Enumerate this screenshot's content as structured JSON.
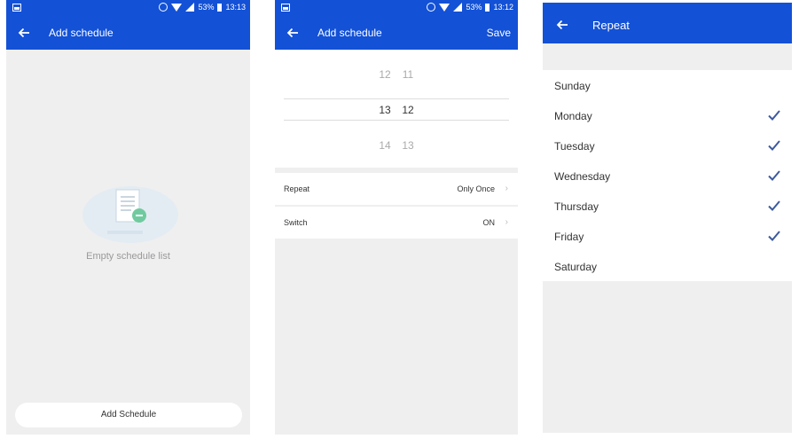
{
  "screen1": {
    "status": {
      "battery": "53%",
      "time": "13:13"
    },
    "title": "Add schedule",
    "empty_text": "Empty schedule list",
    "add_button": "Add Schedule"
  },
  "screen2": {
    "status": {
      "battery": "53%",
      "time": "13:12"
    },
    "title": "Add schedule",
    "save": "Save",
    "picker": {
      "above": [
        "12",
        "11"
      ],
      "selected": [
        "13",
        "12"
      ],
      "below": [
        "14",
        "13"
      ]
    },
    "repeat": {
      "label": "Repeat",
      "value": "Only Once"
    },
    "switch": {
      "label": "Switch",
      "value": "ON"
    }
  },
  "screen3": {
    "title": "Repeat",
    "days": [
      {
        "label": "Sunday",
        "checked": false
      },
      {
        "label": "Monday",
        "checked": true
      },
      {
        "label": "Tuesday",
        "checked": true
      },
      {
        "label": "Wednesday",
        "checked": true
      },
      {
        "label": "Thursday",
        "checked": true
      },
      {
        "label": "Friday",
        "checked": true
      },
      {
        "label": "Saturday",
        "checked": false
      }
    ]
  },
  "colors": {
    "primary": "#1351d6",
    "check": "#3d5a9e",
    "background": "#efefef"
  }
}
